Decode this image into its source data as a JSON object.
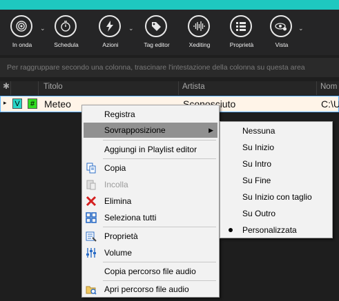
{
  "toolbar": {
    "buttons": [
      {
        "label": "In onda",
        "icon": "broadcast-icon"
      },
      {
        "label": "Schedula",
        "icon": "stopwatch-icon"
      },
      {
        "label": "Azioni",
        "icon": "lightning-icon"
      },
      {
        "label": "Tag editor",
        "icon": "tag-icon"
      },
      {
        "label": "Xediting",
        "icon": "waveform-icon"
      },
      {
        "label": "Proprietà",
        "icon": "list-icon"
      },
      {
        "label": "Vista",
        "icon": "eye-gear-icon"
      }
    ]
  },
  "group_hint": "Per raggruppare secondo una colonna, trascinare l'intestazione della colonna su questa area",
  "grid": {
    "columns": [
      "Titolo",
      "Artista",
      "Nom"
    ],
    "row": {
      "badge1": "V",
      "badge2": "#",
      "title": "Meteo",
      "artist": "Sconosciuto",
      "path": "C:\\U"
    }
  },
  "context_menu": {
    "items": [
      {
        "label": "Registra",
        "icon": ""
      },
      {
        "label": "Sovrapposizione",
        "icon": "",
        "submenu": true
      },
      {
        "label": "Aggiungi in Playlist editor",
        "icon": ""
      },
      {
        "label": "Copia",
        "icon": "copy-icon"
      },
      {
        "label": "Incolla",
        "icon": "paste-icon",
        "disabled": true
      },
      {
        "label": "Elimina",
        "icon": "delete-x-icon"
      },
      {
        "label": "Seleziona tutti",
        "icon": "select-all-icon"
      },
      {
        "label": "Proprietà",
        "icon": "properties-icon"
      },
      {
        "label": "Volume",
        "icon": "volume-sliders-icon"
      },
      {
        "label": "Copia percorso file audio",
        "icon": ""
      },
      {
        "label": "Apri percorso file audio",
        "icon": "open-folder-icon"
      }
    ]
  },
  "submenu": {
    "items": [
      {
        "label": "Nessuna"
      },
      {
        "label": "Su Inizio"
      },
      {
        "label": "Su Intro"
      },
      {
        "label": "Su Fine"
      },
      {
        "label": "Su Inizio con taglio"
      },
      {
        "label": "Su Outro"
      },
      {
        "label": "Personalizzata",
        "selected": true
      }
    ]
  },
  "colors": {
    "accent_strip": "#1ec8c0",
    "row_bg": "#fff4e8",
    "badge_v": "#2ad6c8",
    "badge_hash": "#33dd22",
    "delete_red": "#d42020",
    "icon_blue": "#2a6cc6"
  }
}
